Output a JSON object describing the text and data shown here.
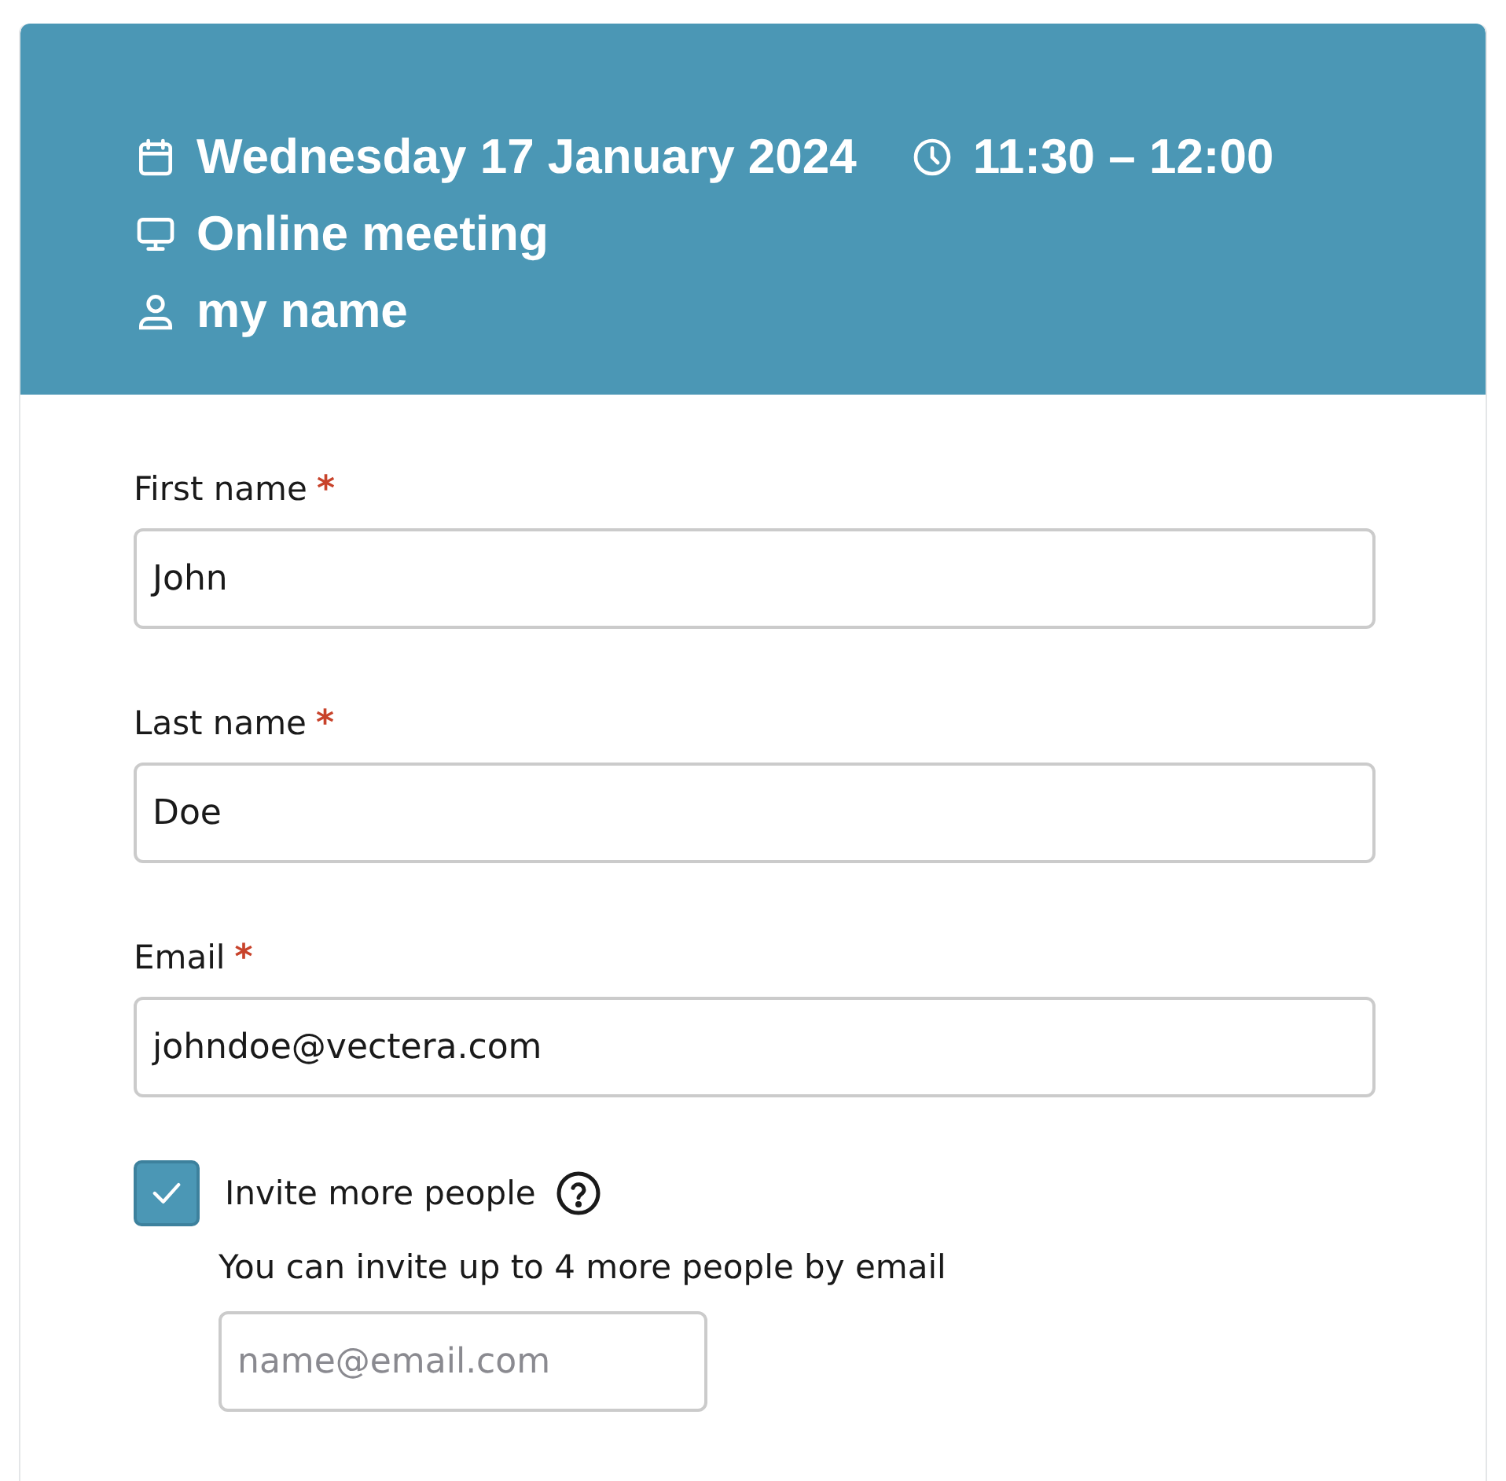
{
  "header": {
    "rows": [
      [
        {
          "kind": "calendar",
          "text": "Wednesday 17 January 2024"
        },
        {
          "kind": "clock",
          "text": "11:30 – 12:00"
        }
      ],
      [
        {
          "kind": "monitor",
          "text": "Online meeting"
        }
      ],
      [
        {
          "kind": "person",
          "text": "my name"
        }
      ]
    ]
  },
  "fields": [
    {
      "label": "First name",
      "required": true,
      "value": "John"
    },
    {
      "label": "Last name",
      "required": true,
      "value": "Doe"
    },
    {
      "label": "Email",
      "required": true,
      "value": "johndoe@vectera.com"
    }
  ],
  "invite": {
    "label": "Invite more people",
    "checked": true,
    "hint": "You can invite up to 4 more people by email",
    "placeholder": "name@email.com"
  },
  "required_mark": "*"
}
